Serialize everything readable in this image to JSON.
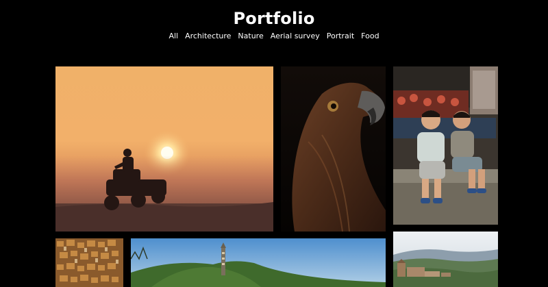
{
  "site": {
    "title": "Portfolio"
  },
  "filters": [
    {
      "label": "All"
    },
    {
      "label": "Architecture"
    },
    {
      "label": "Nature"
    },
    {
      "label": "Aerial survey"
    },
    {
      "label": "Portrait"
    },
    {
      "label": "Food"
    }
  ],
  "gallery": {
    "photos": [
      {
        "subject": "atv-rider-at-sunset"
      },
      {
        "subject": "eagle-portrait"
      },
      {
        "subject": "children-at-market"
      },
      {
        "subject": "old-town-rooftops"
      },
      {
        "subject": "park-hill-with-tower"
      },
      {
        "subject": "hillside-castle-landscape"
      }
    ]
  },
  "colors": {
    "background": "#000000",
    "text": "#ffffff"
  }
}
